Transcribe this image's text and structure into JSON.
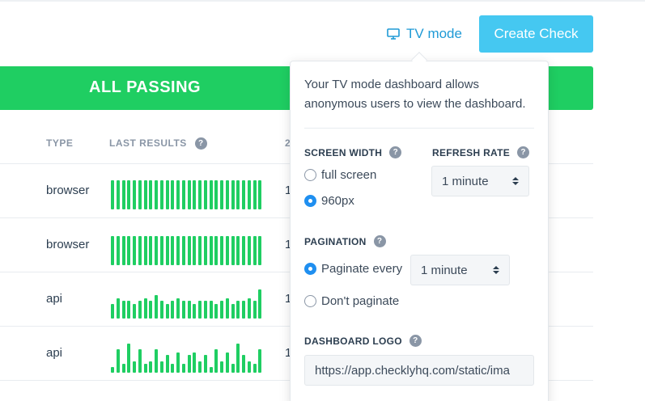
{
  "header": {
    "tv_mode_label": "TV mode",
    "create_check_label": "Create Check"
  },
  "banner": {
    "status": "ALL PASSING",
    "color": "#1fce62"
  },
  "table": {
    "columns": [
      "TYPE",
      "LAST RESULTS",
      "2"
    ],
    "rows": [
      {
        "type": "browser",
        "num": "1",
        "bars": [
          1,
          1,
          1,
          1,
          1,
          1,
          1,
          1,
          1,
          1,
          1,
          1,
          1,
          1,
          1,
          1,
          1,
          1,
          1,
          1,
          1,
          1,
          1,
          1,
          1,
          1,
          1,
          1
        ]
      },
      {
        "type": "browser",
        "num": "1",
        "bars": [
          1,
          1,
          1,
          1,
          1,
          1,
          1,
          1,
          1,
          1,
          1,
          1,
          1,
          1,
          1,
          1,
          1,
          1,
          1,
          1,
          1,
          1,
          1,
          1,
          1,
          1,
          1,
          1
        ]
      },
      {
        "type": "api",
        "num": "1",
        "bars": [
          0.5,
          0.7,
          0.6,
          0.6,
          0.5,
          0.6,
          0.7,
          0.6,
          0.8,
          0.6,
          0.5,
          0.6,
          0.7,
          0.6,
          0.6,
          0.5,
          0.6,
          0.6,
          0.6,
          0.5,
          0.6,
          0.7,
          0.5,
          0.6,
          0.6,
          0.7,
          0.6,
          1
        ]
      },
      {
        "type": "api",
        "num": "1",
        "bars": [
          0.2,
          0.8,
          0.3,
          1,
          0.4,
          0.8,
          0.3,
          0.4,
          0.8,
          0.4,
          0.6,
          0.3,
          0.7,
          0.3,
          0.6,
          0.7,
          0.4,
          0.6,
          0.2,
          0.8,
          0.4,
          0.7,
          0.3,
          1,
          0.6,
          0.4,
          0.3,
          0.8
        ]
      }
    ]
  },
  "popover": {
    "description": "Your TV mode dashboard allows anonymous users to view the dashboard.",
    "screen_width_label": "SCREEN WIDTH",
    "refresh_rate_label": "REFRESH RATE",
    "screen_width_options": [
      {
        "label": "full screen",
        "selected": false
      },
      {
        "label": "960px",
        "selected": true
      }
    ],
    "refresh_rate_value": "1 minute",
    "pagination_label": "PAGINATION",
    "pagination_options": [
      {
        "label": "Paginate every",
        "selected": true
      },
      {
        "label": "Don't paginate",
        "selected": false
      }
    ],
    "paginate_interval_value": "1 minute",
    "dashboard_logo_label": "DASHBOARD LOGO",
    "dashboard_logo_value": "https://app.checklyhq.com/static/ima",
    "help_glyph": "?"
  },
  "colors": {
    "accent_blue": "#1f9ad6",
    "button_blue": "#45c8f1",
    "pass_green": "#1fce62",
    "radio_selected": "#1f8ff0"
  },
  "icons": {
    "tv_mode": "monitor-icon",
    "help": "question-icon"
  }
}
